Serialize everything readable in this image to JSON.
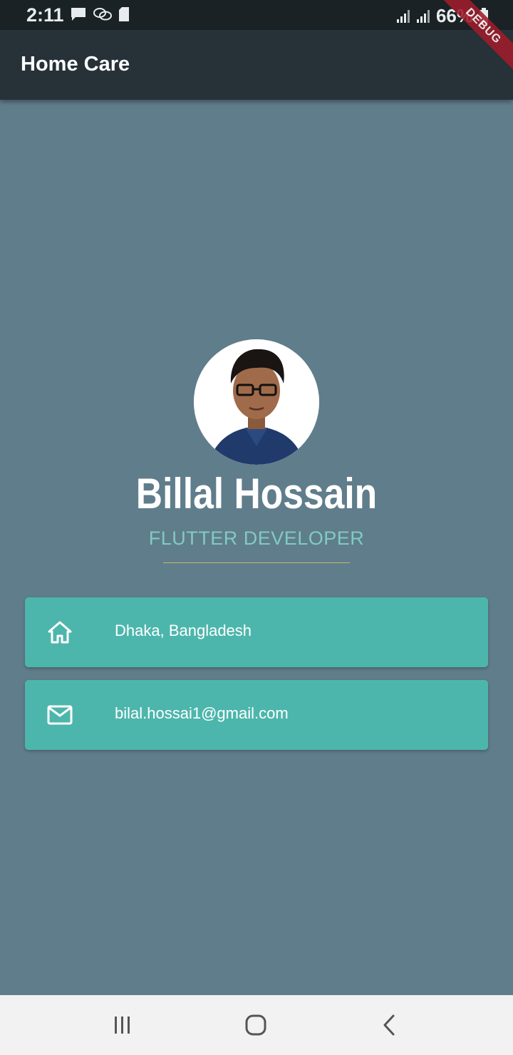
{
  "status_bar": {
    "time": "2:11",
    "battery": "66%",
    "icons_left": [
      "message-icon",
      "chat-icon",
      "sd-card-icon"
    ],
    "icons_right": [
      "signal-icon",
      "signal-icon",
      "battery-icon"
    ]
  },
  "debug_banner": "DEBUG",
  "app_bar": {
    "title": "Home Care"
  },
  "profile": {
    "name": "Billal Hossain",
    "role": "FLUTTER DEVELOPER"
  },
  "cards": [
    {
      "icon": "home-icon",
      "text": "Dhaka, Bangladesh"
    },
    {
      "icon": "mail-icon",
      "text": "bilal.hossai1@gmail.com"
    }
  ],
  "nav": {
    "buttons": [
      "recents-icon",
      "home-icon",
      "back-icon"
    ]
  },
  "colors": {
    "background": "#607d8b",
    "app_bar": "#263238",
    "card": "#4db6ac",
    "role_text": "#80cbc4",
    "divider": "#c7b86a",
    "debug_ribbon": "#a01c2b"
  }
}
